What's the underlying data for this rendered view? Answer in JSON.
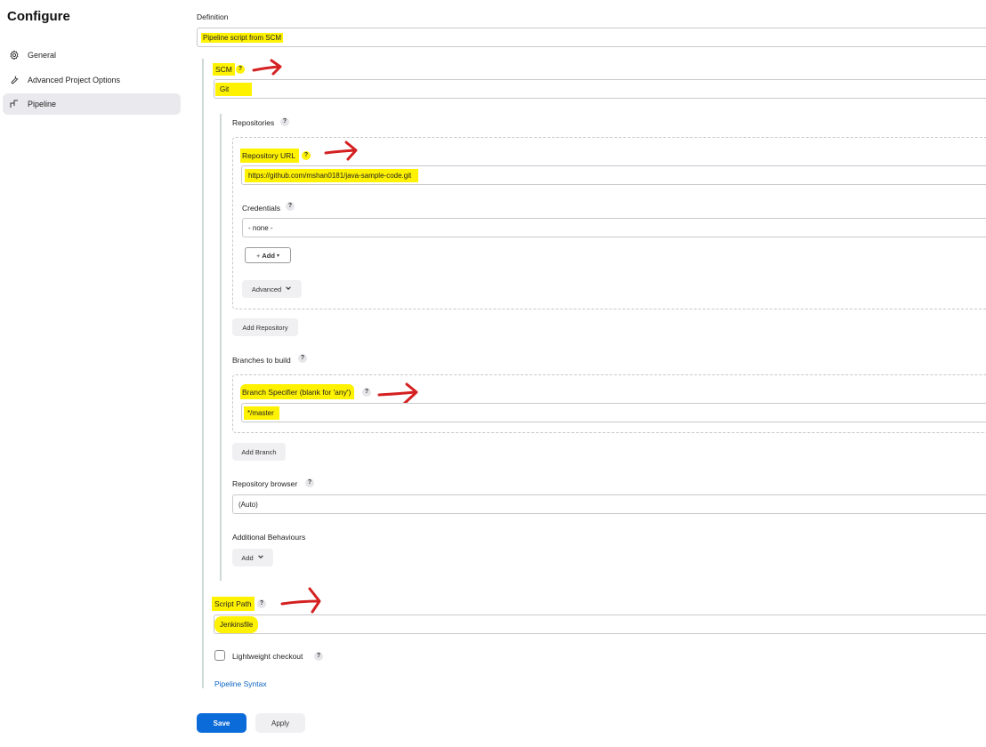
{
  "sidebar": {
    "title": "Configure",
    "items": [
      {
        "label": "General",
        "icon": "gear-icon"
      },
      {
        "label": "Advanced Project Options",
        "icon": "wrench-icon"
      },
      {
        "label": "Pipeline",
        "icon": "pipeline-icon",
        "active": true
      }
    ]
  },
  "definition": {
    "label": "Definition",
    "value": "Pipeline script from SCM"
  },
  "scm": {
    "label": "SCM",
    "value": "Git"
  },
  "repositories": {
    "label": "Repositories",
    "url_label": "Repository URL",
    "url_value": "https://github.com/mshan0181/java-sample-code.git",
    "credentials_label": "Credentials",
    "credentials_value": "- none -",
    "add_button": "Add",
    "advanced_button": "Advanced",
    "add_repository_button": "Add Repository"
  },
  "branches": {
    "label": "Branches to build",
    "specifier_label": "Branch Specifier (blank for 'any')",
    "specifier_value": "*/master",
    "add_branch_button": "Add Branch"
  },
  "repo_browser": {
    "label": "Repository browser",
    "value": "(Auto)"
  },
  "behaviours": {
    "label": "Additional Behaviours",
    "add_button": "Add"
  },
  "script_path": {
    "label": "Script Path",
    "value": "Jenkinsfile"
  },
  "lightweight": {
    "label": "Lightweight checkout",
    "checked": false
  },
  "pipeline_syntax_link": "Pipeline Syntax",
  "actions": {
    "save": "Save",
    "apply": "Apply"
  },
  "help_glyph": "?",
  "colors": {
    "highlight": "#fff200",
    "annotation_arrow": "#d42020",
    "primary": "#0b6bd8",
    "link": "#0b63c4"
  }
}
